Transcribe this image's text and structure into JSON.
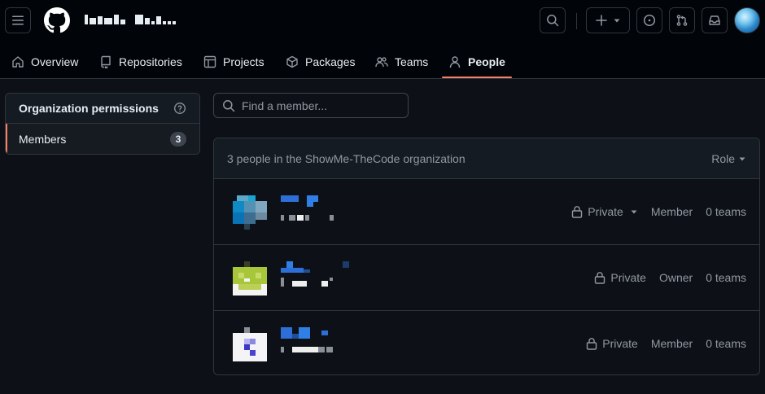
{
  "header": {
    "org_name_redacted": "redacted-org-name",
    "icons": {
      "menu": "three-bars-icon",
      "logo": "github-mark-icon",
      "search": "search-icon",
      "create": "plus-icon",
      "issues": "issue-opened-icon",
      "pulls": "git-pull-request-icon",
      "inbox": "inbox-icon"
    }
  },
  "tabs": [
    {
      "label": "Overview",
      "icon": "home-icon"
    },
    {
      "label": "Repositories",
      "icon": "repo-icon"
    },
    {
      "label": "Projects",
      "icon": "table-icon"
    },
    {
      "label": "Packages",
      "icon": "package-icon"
    },
    {
      "label": "Teams",
      "icon": "people-icon"
    },
    {
      "label": "People",
      "icon": "person-icon",
      "selected": true
    }
  ],
  "sidebar": {
    "title": "Organization permissions",
    "items": [
      {
        "label": "Members",
        "count": "3",
        "selected": true
      }
    ]
  },
  "search": {
    "placeholder": "Find a member..."
  },
  "members": {
    "summary": "3 people in the ShowMe-TheCode organization",
    "role_filter": "Role",
    "rows": [
      {
        "visibility": "Private",
        "visibility_dropdown": true,
        "role": "Member",
        "teams": "0 teams"
      },
      {
        "visibility": "Private",
        "visibility_dropdown": false,
        "role": "Owner",
        "teams": "0 teams"
      },
      {
        "visibility": "Private",
        "visibility_dropdown": false,
        "role": "Member",
        "teams": "0 teams"
      }
    ]
  },
  "colors": {
    "accent": "#f78166",
    "bg": "#0d1117",
    "header_bg": "#010409",
    "border": "#30363d",
    "muted": "#9198a1"
  }
}
